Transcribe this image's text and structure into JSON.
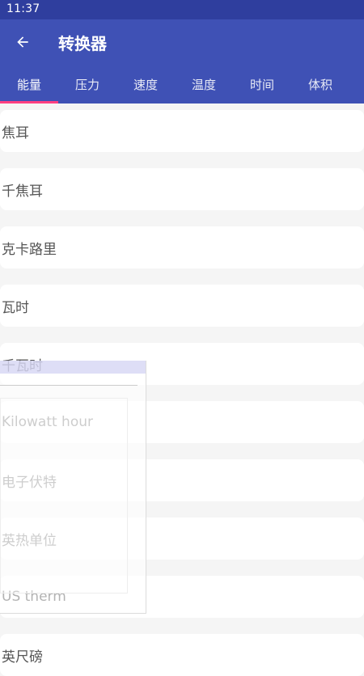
{
  "status_bar": {
    "time": "11:37"
  },
  "app_bar": {
    "title": "转换器",
    "back_icon": "arrow-back-icon"
  },
  "tabs": [
    {
      "label": "能量",
      "active": true
    },
    {
      "label": "压力",
      "active": false
    },
    {
      "label": "速度",
      "active": false
    },
    {
      "label": "温度",
      "active": false
    },
    {
      "label": "时间",
      "active": false
    },
    {
      "label": "体积",
      "active": false
    }
  ],
  "units": [
    "焦耳",
    "千焦耳",
    "克卡路里",
    "瓦时",
    "千瓦时",
    "Kilowatt hour",
    "电子伏特",
    "英热单位",
    "US therm",
    "英尺磅"
  ],
  "colors": {
    "status_bar": "#2f3e9e",
    "app_bar": "#3f51b5",
    "tab_indicator": "#ff4081",
    "background": "#f5f5f5"
  }
}
